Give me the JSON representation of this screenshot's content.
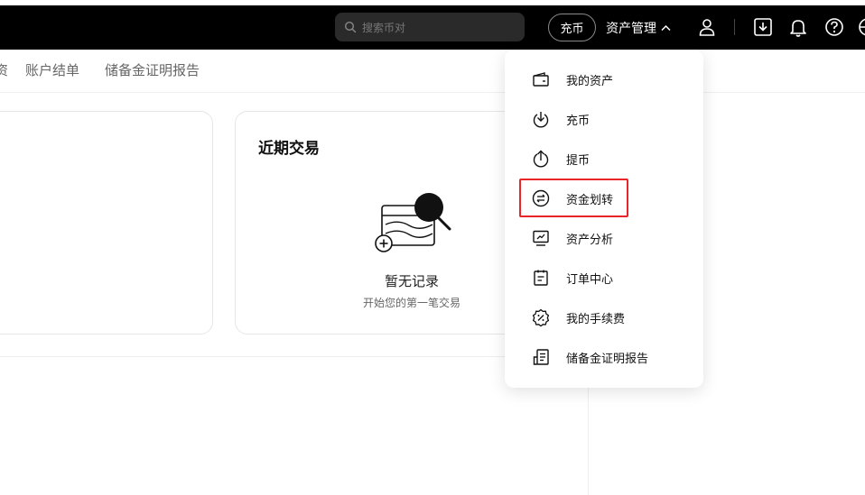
{
  "topbar": {
    "search_placeholder": "搜索币对",
    "deposit_button": "充币",
    "asset_management": "资产管理"
  },
  "subnav": {
    "items": [
      "资",
      "账户结单",
      "储备金证明报告"
    ]
  },
  "recent_trades": {
    "title": "近期交易",
    "empty_title": "暂无记录",
    "empty_subtitle": "开始您的第一笔交易"
  },
  "dropdown": {
    "items": [
      {
        "label": "我的资产",
        "icon": "wallet-icon"
      },
      {
        "label": "充币",
        "icon": "download-icon"
      },
      {
        "label": "提币",
        "icon": "upload-icon"
      },
      {
        "label": "资金划转",
        "icon": "transfer-icon"
      },
      {
        "label": "资产分析",
        "icon": "analysis-icon"
      },
      {
        "label": "订单中心",
        "icon": "order-icon"
      },
      {
        "label": "我的手续费",
        "icon": "fee-icon"
      },
      {
        "label": "储备金证明报告",
        "icon": "report-icon"
      }
    ],
    "highlighted": "资金划转"
  },
  "colors": {
    "topbar_bg": "#000000",
    "highlight": "#e8262a"
  }
}
